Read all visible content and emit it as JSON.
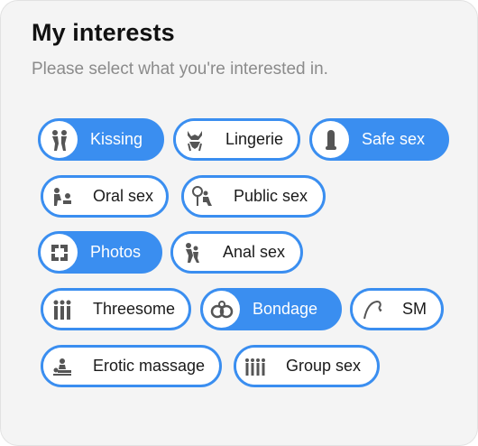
{
  "header": {
    "title": "My interests",
    "subtitle": "Please select what you're interested in."
  },
  "accent_color": "#3a8ef0",
  "interests": [
    {
      "label": "Kissing",
      "icon": "kissing-icon",
      "selected": true
    },
    {
      "label": "Lingerie",
      "icon": "lingerie-icon",
      "selected": false
    },
    {
      "label": "Safe sex",
      "icon": "condom-icon",
      "selected": true
    },
    {
      "label": "Oral sex",
      "icon": "oral-sex-icon",
      "selected": false
    },
    {
      "label": "Public sex",
      "icon": "public-sex-icon",
      "selected": false
    },
    {
      "label": "Photos",
      "icon": "photos-icon",
      "selected": true
    },
    {
      "label": "Anal sex",
      "icon": "anal-sex-icon",
      "selected": false
    },
    {
      "label": "Threesome",
      "icon": "threesome-icon",
      "selected": false
    },
    {
      "label": "Bondage",
      "icon": "handcuffs-icon",
      "selected": true
    },
    {
      "label": "SM",
      "icon": "whip-icon",
      "selected": false
    },
    {
      "label": "Erotic massage",
      "icon": "massage-icon",
      "selected": false
    },
    {
      "label": "Group sex",
      "icon": "group-sex-icon",
      "selected": false
    }
  ]
}
